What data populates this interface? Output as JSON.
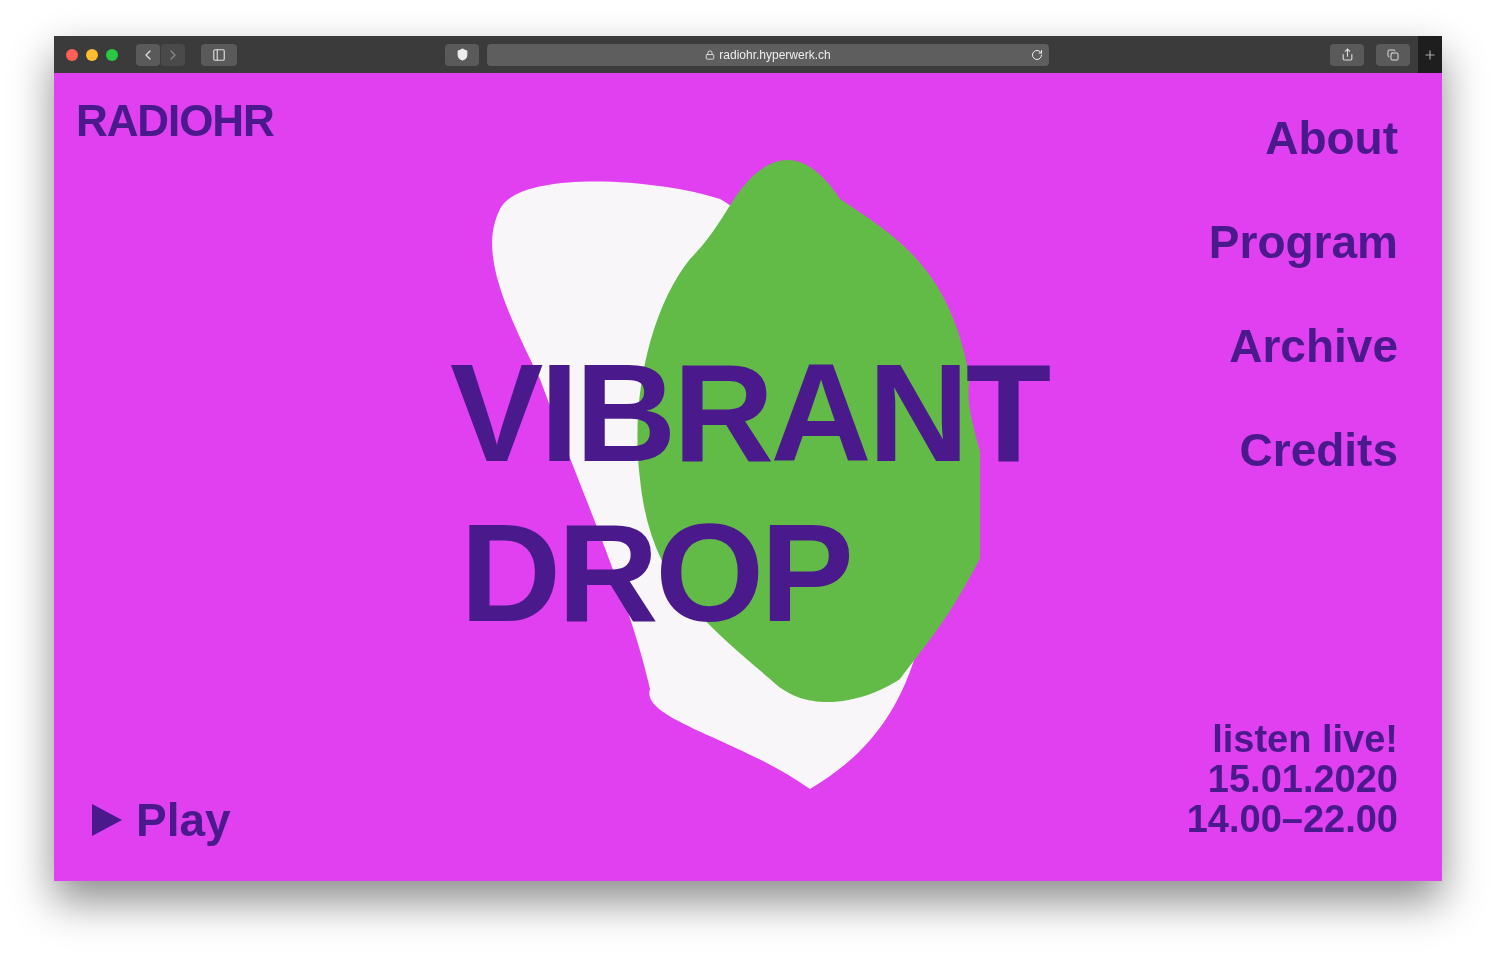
{
  "browser": {
    "url": "radiohr.hyperwerk.ch"
  },
  "logo": "RADIOHR",
  "nav": [
    {
      "label": "About"
    },
    {
      "label": "Program"
    },
    {
      "label": "Archive"
    },
    {
      "label": "Credits"
    }
  ],
  "title": {
    "lines": [
      "VIBRANT",
      "DROP"
    ]
  },
  "player": {
    "label": "Play"
  },
  "event": {
    "lines": [
      "listen live!",
      "15.01.2020",
      "14.00–22.00"
    ]
  }
}
